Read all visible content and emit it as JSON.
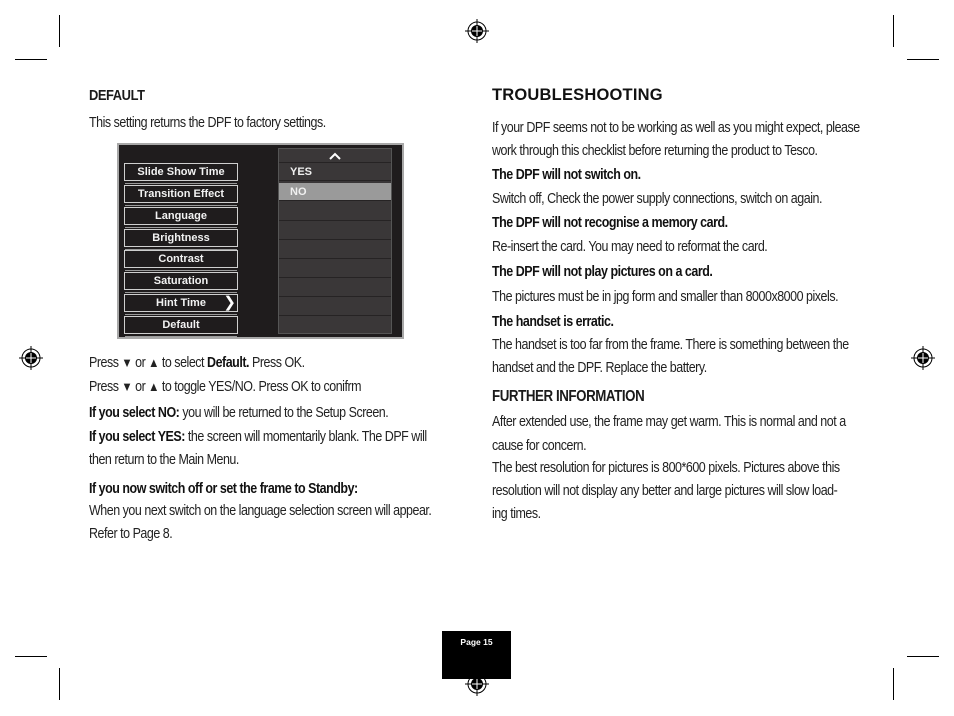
{
  "left": {
    "heading": "DEFAULT",
    "intro": "This setting returns the DPF to factory settings.",
    "screen": {
      "menu_items": [
        "Slide Show Time",
        "Transition Effect",
        "Language",
        "Brightness",
        "Contrast",
        "Saturation",
        "Hint Time",
        "Default"
      ],
      "options": [
        "YES",
        "NO"
      ],
      "selected_option": "NO",
      "scroll_up_icon": "chevron-up",
      "submenu_icon": "chevron-right"
    },
    "press1": {
      "pre": "Press",
      "or": "or",
      "post": "to select",
      "bold": "Default.",
      "end": "Press OK."
    },
    "press2": {
      "pre": "Press",
      "or": "or",
      "post": "to toggle YES/NO. Press OK to conifrm"
    },
    "no_label": "If you select NO:",
    "no_text": "you will be returned to the Setup Screen.",
    "yes_label": "If you select YES:",
    "yes_text": "the screen will momentarily blank. The DPF will",
    "yes_text2": "then return to the Main Menu.",
    "standby_heading": "If you now switch off or set the frame to Standby:",
    "standby_text1": "When you next switch on the language selection screen will appear.",
    "standby_text2": "Refer to Page 8."
  },
  "right": {
    "heading": "TROUBLESHOOTING",
    "intro1": "If your DPF seems not to be working as well as you might expect, please",
    "intro2": "work through this checklist before returning the product to Tesco.",
    "items": [
      {
        "q": "The DPF will not switch on.",
        "a": [
          "Switch off, Check the power supply connections, switch on again."
        ]
      },
      {
        "q": "The DPF will not recognise a memory card.",
        "a": [
          "Re-insert the card. You may need to reformat the card."
        ]
      },
      {
        "q": "The DPF will not play pictures on a card.",
        "a": [
          "The pictures must be in jpg form and smaller than 8000x8000 pixels."
        ]
      },
      {
        "q": "The handset is erratic.",
        "a": [
          "The handset is too far from the frame. There is something between the",
          "handset and the DPF. Replace the battery."
        ]
      }
    ],
    "further_heading": "FURTHER INFORMATION",
    "further": [
      "After extended use, the frame may get warm. This is normal and not a",
      "cause for concern.",
      "The best resolution for pictures is 800*600 pixels. Pictures above this",
      "resolution will not display any better and large pictures will slow load-",
      "ing times."
    ]
  },
  "footer": {
    "page_label": "Page 15"
  }
}
